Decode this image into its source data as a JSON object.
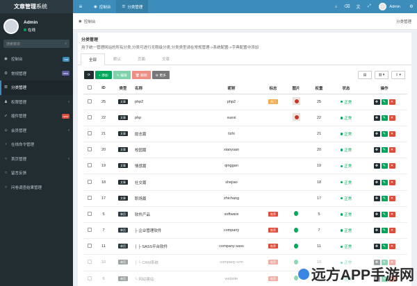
{
  "app": {
    "logo_bold": "文章管理",
    "logo_light": "系统"
  },
  "topnav": {
    "tabs": [
      {
        "label": "控制台",
        "icon": "dashboard-icon"
      },
      {
        "label": "分类管理",
        "icon": "list-icon",
        "active": true
      }
    ],
    "user_name": "Admin"
  },
  "sidebar": {
    "user_name": "Admin",
    "user_status": "在线",
    "search_placeholder": "搜索菜单",
    "items": [
      {
        "label": "控制台",
        "icon": "dashboard-icon",
        "badge": "hot",
        "badge_color": "#3c8dbc"
      },
      {
        "label": "常规管理",
        "icon": "cog-icon",
        "badge": "new",
        "badge_color": "#605ca8"
      },
      {
        "label": "分类管理",
        "icon": "list-icon",
        "active": true
      },
      {
        "label": "权限管理",
        "icon": "group-icon",
        "chevron": true
      },
      {
        "label": "插件管理",
        "icon": "rocket-icon",
        "badge": "new",
        "badge_color": "#dd4b39"
      },
      {
        "label": "会员管理",
        "icon": "user-icon",
        "chevron": true
      },
      {
        "label": "在线命令管理",
        "icon": "terminal-icon"
      },
      {
        "label": "首页管理",
        "icon": "circle-icon",
        "chevron": true
      },
      {
        "label": "留言反馈",
        "icon": "circle-icon"
      },
      {
        "label": "问卷调查结果管理",
        "icon": "circle-icon"
      }
    ]
  },
  "breadcrumb": {
    "left": "控制台",
    "right": "分类管理"
  },
  "panel": {
    "title": "分类管理",
    "description": "用于统一管理网站的所有分类,分类可进行无限级分类,分类类型请在常规管理->系统配置->字典配置中添加",
    "tabs": [
      "全部",
      "默认",
      "页面",
      "文章"
    ]
  },
  "toolbar": {
    "refresh": "⟳",
    "add": "+ 添加",
    "edit": "✎ 编辑",
    "delete": "🗑 删除",
    "more": "⚙ 更多",
    "right_buttons": [
      "▤",
      "▥ ▾",
      "⇩ ▾"
    ]
  },
  "table": {
    "headers": [
      "",
      "ID",
      "类型",
      "名称",
      "昵称",
      "标志",
      "图片",
      "权重",
      "状态",
      "操作"
    ],
    "rows": [
      {
        "id": "25",
        "type": "文章",
        "name": "php2",
        "nickname": "php2",
        "flag": "热门",
        "image": "thumb",
        "weight": "25",
        "status": "正常"
      },
      {
        "id": "22",
        "type": "文章",
        "name": "php",
        "nickname": "xuexi",
        "flag": "",
        "image": "thumb",
        "weight": "22",
        "status": "正常"
      },
      {
        "id": "21",
        "type": "文章",
        "name": "励志篇",
        "nickname": "lizhi",
        "flag": "",
        "image": "",
        "weight": "21",
        "status": "正常"
      },
      {
        "id": "20",
        "type": "文章",
        "name": "校园篇",
        "nickname": "xiaoyuan",
        "flag": "",
        "image": "",
        "weight": "20",
        "status": "正常"
      },
      {
        "id": "19",
        "type": "文章",
        "name": "情感篇",
        "nickname": "qinggan",
        "flag": "",
        "image": "",
        "weight": "19",
        "status": "正常"
      },
      {
        "id": "18",
        "type": "文章",
        "name": "社交篇",
        "nickname": "shejiao",
        "flag": "",
        "image": "",
        "weight": "18",
        "status": "正常"
      },
      {
        "id": "17",
        "type": "文章",
        "name": "职场篇",
        "nickname": "zhichang",
        "flag": "",
        "image": "",
        "weight": "17",
        "status": "正常"
      },
      {
        "id": "5",
        "type": "单页",
        "name": "软件产品",
        "nickname": "software",
        "flag": "推荐",
        "image": "icon",
        "weight": "5",
        "status": "正常"
      },
      {
        "id": "7",
        "type": "单页",
        "name": "├ 企业管理软件",
        "nickname": "company",
        "flag": "推荐",
        "image": "icon",
        "weight": "7",
        "status": "正常"
      },
      {
        "id": "11",
        "type": "单页",
        "name": "│ ├ SASS平台软件",
        "nickname": "company-sass",
        "flag": "推荐",
        "image": "icon",
        "weight": "11",
        "status": "正常"
      },
      {
        "id": "10",
        "type": "单页",
        "name": "│ └ CRM系统",
        "nickname": "company-crm",
        "flag": "推荐",
        "image": "icon",
        "weight": "10",
        "status": "正常",
        "faded": true
      },
      {
        "id": "6",
        "type": "单页",
        "name": "└ 网站建站",
        "nickname": "website",
        "flag": "推荐",
        "image": "icon",
        "weight": "6",
        "status": "正常",
        "faded": true
      }
    ]
  },
  "watermark": "远方APP手游网",
  "colors": {
    "header_blue": "#3c8dbc",
    "sidebar_dark": "#222d32",
    "success": "#00a65a",
    "danger": "#dd4b39",
    "warning": "#f0ad4e"
  }
}
